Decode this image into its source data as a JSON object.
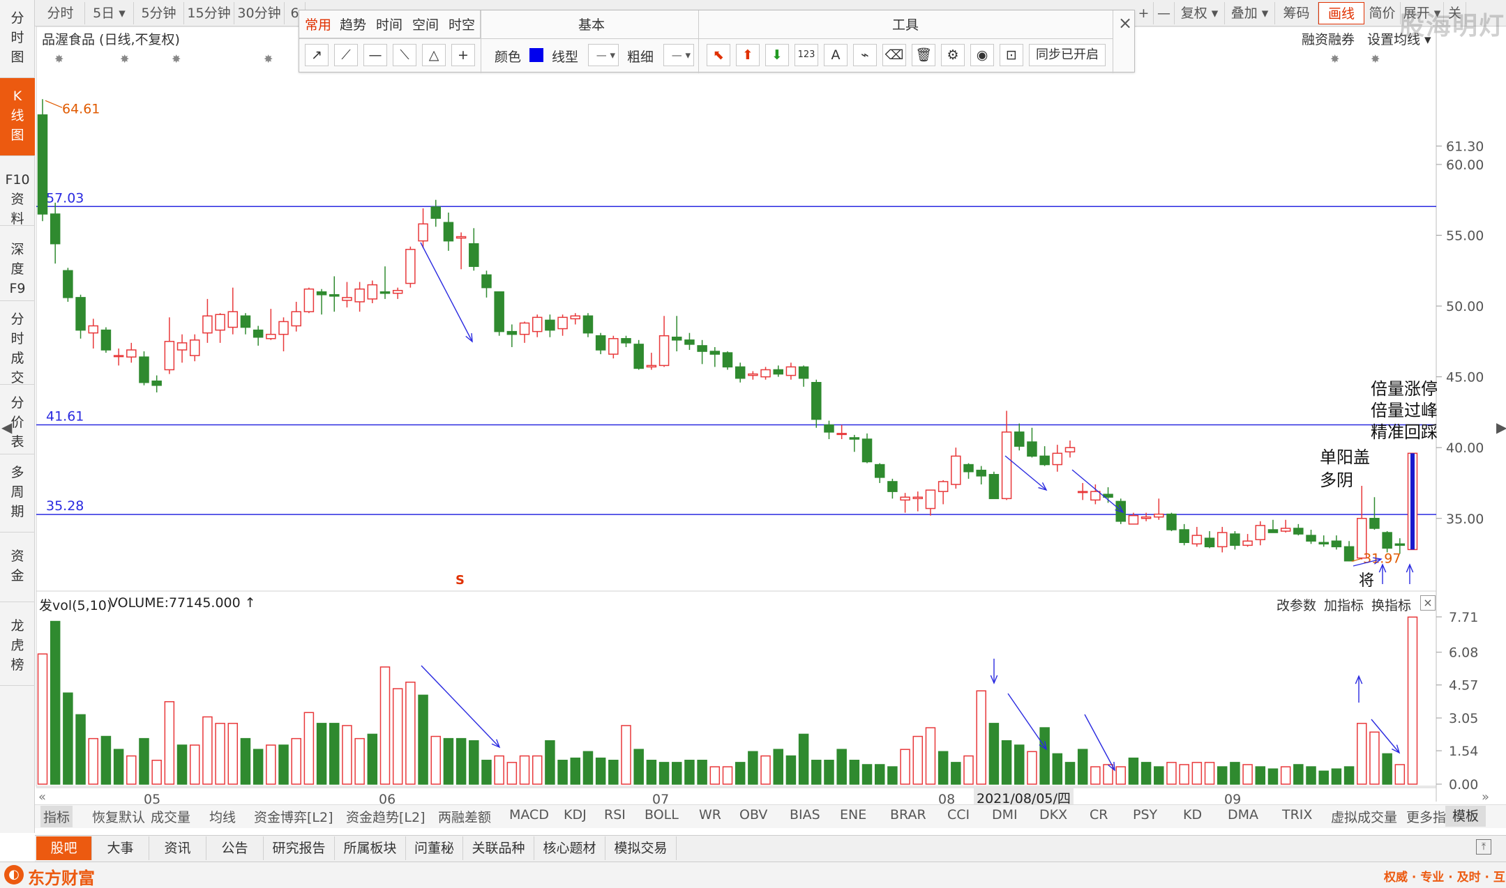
{
  "sidebar": [
    {
      "label": "分\n时\n图",
      "active": false
    },
    {
      "label": "K\n线\n图",
      "active": true
    },
    {
      "label": "F10\n资\n料",
      "active": false
    },
    {
      "label": "深\n度\nF9",
      "active": false
    },
    {
      "label": "分\n时\n成\n交",
      "active": false
    },
    {
      "label": "分\n价\n表",
      "active": false
    },
    {
      "label": "多\n周\n期",
      "active": false
    },
    {
      "label": "资\n金",
      "active": false
    },
    {
      "label": "龙\n虎\n榜",
      "active": false
    }
  ],
  "period_tabs": [
    "分时",
    "5日 ▾",
    "5分钟",
    "15分钟",
    "30分钟",
    "6"
  ],
  "right_tabs": [
    "+",
    "—",
    "复权 ▾",
    "叠加 ▾",
    "筹码",
    "画线",
    "简价",
    "展开 ▾",
    "关"
  ],
  "active_right_tab": "画线",
  "stock_title": "品渥食品 (日线,不复权)",
  "links": {
    "margin": "融资融券",
    "ma": "设置均线 ▾"
  },
  "toolbox": {
    "tabs": [
      "常用",
      "趋势",
      "时间",
      "空间",
      "时空"
    ],
    "section_basic": "基本",
    "section_tools": "工具",
    "color_label": "颜色",
    "line_label": "线型",
    "width_label": "粗细",
    "sync_label": "同步已开启",
    "close": "×"
  },
  "price_labels": [
    "61.30",
    "60.00",
    "55.00",
    "50.00",
    "45.00",
    "40.00",
    "35.00"
  ],
  "hlines": [
    {
      "value": 57.03,
      "label": "57.03"
    },
    {
      "value": 41.61,
      "label": "41.61"
    },
    {
      "value": 35.28,
      "label": "35.28"
    }
  ],
  "high_marker": "64.61",
  "low_marker": "31.97",
  "s_marker": "S",
  "jiang_marker": "将",
  "annotations": {
    "a1": "倍量涨停",
    "a2": "倍量过峰",
    "a3": "精准回踩",
    "b1": "单阳盖",
    "b2": "多阴"
  },
  "volume": {
    "title": "发vol(5,10)",
    "value_text": "VOLUME:77145.000 ↑",
    "actions": [
      "改参数",
      "加指标",
      "换指标"
    ],
    "scale": [
      "7.71",
      "6.08",
      "4.57",
      "3.05",
      "1.54",
      "0.00"
    ]
  },
  "month_labels": [
    "05",
    "06",
    "07",
    "08",
    "2021/08/05/四",
    "09"
  ],
  "indicator_tabs": [
    "指标",
    "恢复默认",
    "成交量",
    "均线",
    "资金博弈[L2]",
    "资金趋势[L2]",
    "两融差额",
    "MACD",
    "KDJ",
    "RSI",
    "BOLL",
    "WR",
    "OBV",
    "BIAS",
    "ENE",
    "BRAR",
    "CCI",
    "DMI",
    "DKX",
    "CR",
    "PSY",
    "KD",
    "DMA",
    "TRIX",
    "虚拟成交量",
    "更多指标"
  ],
  "template_tab": "模板",
  "bottom_tabs": [
    "股吧",
    "大事",
    "资讯",
    "公告",
    "研究报告",
    "所属板块",
    "问董秘",
    "关联品种",
    "核心题材",
    "模拟交易"
  ],
  "brand": "东方财富",
  "slogan": "权威 · 专业 · 及时 · 互动",
  "watermark": "股海明灯",
  "colors": {
    "up": "#e8383a",
    "down": "#2f8a2f",
    "accent": "#ec5a10",
    "hline": "#2a2ae0"
  },
  "chart_data": {
    "type": "candlestick",
    "ylim": [
      31.0,
      66.2
    ],
    "candles": [
      [
        63.5,
        56.5,
        64.61,
        56.0
      ],
      [
        56.5,
        54.4,
        57.3,
        53.0
      ],
      [
        52.5,
        50.6,
        52.7,
        50.3
      ],
      [
        50.6,
        48.3,
        50.8,
        47.7
      ],
      [
        48.1,
        48.6,
        49.1,
        47.0
      ],
      [
        48.3,
        46.9,
        48.5,
        46.7
      ],
      [
        46.5,
        46.5,
        47.0,
        45.8
      ],
      [
        46.4,
        46.9,
        47.4,
        46.0
      ],
      [
        46.4,
        44.6,
        46.8,
        44.4
      ],
      [
        44.7,
        44.4,
        45.1,
        43.9
      ],
      [
        45.5,
        47.5,
        49.2,
        45.2
      ],
      [
        46.9,
        47.4,
        48.0,
        46.0
      ],
      [
        46.5,
        47.6,
        48.0,
        46.1
      ],
      [
        48.1,
        49.3,
        50.5,
        47.4
      ],
      [
        48.3,
        49.4,
        49.5,
        47.4
      ],
      [
        48.5,
        49.6,
        51.3,
        48.0
      ],
      [
        49.3,
        48.5,
        49.5,
        48.0
      ],
      [
        48.3,
        47.8,
        48.6,
        47.2
      ],
      [
        47.7,
        48.0,
        49.8,
        47.6
      ],
      [
        48.0,
        48.9,
        49.2,
        46.8
      ],
      [
        48.6,
        49.6,
        50.3,
        48.2
      ],
      [
        49.6,
        51.2,
        51.3,
        49.5
      ],
      [
        51.0,
        50.8,
        51.2,
        49.4
      ],
      [
        50.8,
        50.7,
        52.1,
        49.6
      ],
      [
        50.4,
        50.6,
        51.7,
        49.9
      ],
      [
        50.3,
        51.2,
        51.7,
        49.6
      ],
      [
        50.5,
        51.5,
        51.8,
        50.2
      ],
      [
        51.0,
        50.9,
        52.8,
        50.5
      ],
      [
        50.9,
        51.1,
        51.3,
        50.5
      ],
      [
        51.6,
        54.0,
        54.2,
        51.3
      ],
      [
        54.6,
        55.8,
        56.9,
        54.1
      ],
      [
        57.0,
        56.2,
        57.5,
        55.6
      ],
      [
        55.9,
        54.6,
        56.6,
        53.9
      ],
      [
        54.8,
        54.9,
        55.2,
        52.6
      ],
      [
        54.4,
        52.8,
        55.5,
        52.5
      ],
      [
        52.2,
        51.3,
        52.5,
        50.6
      ],
      [
        51.0,
        48.2,
        51.0,
        47.9
      ],
      [
        48.2,
        48.0,
        48.7,
        47.1
      ],
      [
        48.0,
        48.8,
        48.9,
        47.4
      ],
      [
        48.2,
        49.2,
        49.4,
        47.8
      ],
      [
        49.0,
        48.3,
        49.4,
        47.8
      ],
      [
        48.4,
        49.2,
        49.4,
        47.9
      ],
      [
        49.1,
        49.3,
        49.5,
        48.7
      ],
      [
        49.3,
        48.1,
        49.5,
        47.8
      ],
      [
        47.9,
        46.9,
        48.1,
        46.6
      ],
      [
        46.6,
        47.7,
        47.9,
        46.3
      ],
      [
        47.7,
        47.4,
        47.9,
        47.1
      ],
      [
        47.3,
        45.6,
        47.6,
        45.5
      ],
      [
        45.7,
        45.8,
        46.7,
        45.5
      ],
      [
        45.8,
        47.9,
        49.3,
        45.7
      ],
      [
        47.8,
        47.6,
        49.3,
        46.8
      ],
      [
        47.6,
        47.3,
        48.1,
        46.9
      ],
      [
        47.2,
        46.8,
        47.6,
        45.9
      ],
      [
        46.8,
        46.6,
        47.1,
        45.7
      ],
      [
        46.7,
        45.7,
        46.8,
        45.5
      ],
      [
        45.7,
        44.9,
        46.0,
        44.6
      ],
      [
        45.1,
        45.2,
        45.4,
        44.8
      ],
      [
        45.0,
        45.5,
        45.7,
        44.8
      ],
      [
        45.5,
        45.2,
        45.8,
        45.0
      ],
      [
        45.1,
        45.7,
        46.0,
        44.8
      ],
      [
        45.7,
        44.9,
        45.8,
        44.3
      ],
      [
        44.6,
        42.0,
        44.8,
        41.4
      ],
      [
        41.6,
        41.1,
        41.9,
        40.6
      ],
      [
        41.0,
        41.0,
        41.6,
        40.6
      ],
      [
        40.7,
        40.6,
        40.9,
        39.7
      ],
      [
        40.6,
        39.0,
        41.0,
        38.9
      ],
      [
        38.8,
        37.9,
        38.9,
        37.5
      ],
      [
        37.6,
        36.9,
        37.8,
        36.4
      ],
      [
        36.3,
        36.5,
        36.8,
        35.4
      ],
      [
        36.4,
        36.5,
        36.9,
        35.5
      ],
      [
        35.7,
        37.0,
        37.0,
        35.2
      ],
      [
        36.9,
        37.6,
        37.7,
        36.0
      ],
      [
        37.4,
        39.4,
        40.0,
        37.1
      ],
      [
        38.8,
        38.3,
        38.9,
        37.8
      ],
      [
        38.4,
        38.0,
        38.7,
        37.4
      ],
      [
        38.1,
        36.4,
        38.3,
        36.4
      ],
      [
        36.4,
        41.1,
        42.6,
        36.3
      ],
      [
        41.1,
        40.1,
        41.7,
        39.8
      ],
      [
        40.4,
        39.4,
        41.4,
        39.3
      ],
      [
        39.4,
        38.8,
        40.1,
        38.7
      ],
      [
        38.8,
        39.6,
        40.2,
        38.3
      ],
      [
        39.7,
        40.0,
        40.5,
        39.3
      ],
      [
        36.9,
        36.9,
        37.5,
        36.3
      ],
      [
        36.3,
        36.9,
        37.4,
        36.0
      ],
      [
        36.7,
        36.5,
        37.2,
        36.1
      ],
      [
        36.2,
        34.8,
        36.4,
        34.6
      ],
      [
        34.6,
        35.2,
        35.4,
        34.7
      ],
      [
        35.0,
        35.1,
        35.4,
        34.8
      ],
      [
        35.1,
        35.3,
        36.4,
        34.9
      ],
      [
        35.3,
        34.2,
        35.4,
        34.1
      ],
      [
        34.2,
        33.3,
        34.6,
        33.1
      ],
      [
        33.2,
        33.8,
        34.4,
        33.0
      ],
      [
        33.6,
        33.0,
        34.1,
        32.9
      ],
      [
        33.0,
        34.0,
        34.4,
        32.6
      ],
      [
        33.9,
        33.1,
        34.1,
        32.8
      ],
      [
        33.1,
        33.4,
        33.9,
        33.0
      ],
      [
        33.5,
        34.5,
        34.8,
        33.1
      ],
      [
        34.2,
        34.0,
        34.9,
        34.0
      ],
      [
        34.1,
        34.3,
        34.9,
        34.0
      ],
      [
        34.3,
        33.9,
        34.6,
        33.8
      ],
      [
        33.8,
        33.4,
        34.2,
        33.2
      ],
      [
        33.3,
        33.2,
        33.8,
        33.0
      ],
      [
        33.4,
        33.0,
        33.8,
        32.8
      ],
      [
        33.0,
        32.0,
        33.4,
        31.97
      ],
      [
        32.2,
        35.0,
        37.3,
        32.1
      ],
      [
        35.0,
        34.3,
        36.5,
        34.2
      ],
      [
        34.0,
        32.9,
        34.1,
        32.6
      ],
      [
        33.2,
        33.1,
        33.6,
        32.5
      ],
      [
        32.8,
        39.6,
        39.6,
        32.8
      ]
    ],
    "volume_ylim": [
      0,
      7.71
    ],
    "volumes": [
      [
        6.0,
        1
      ],
      [
        7.5,
        0
      ],
      [
        4.2,
        0
      ],
      [
        3.2,
        0
      ],
      [
        2.1,
        1
      ],
      [
        2.2,
        0
      ],
      [
        1.6,
        0
      ],
      [
        1.3,
        1
      ],
      [
        2.1,
        0
      ],
      [
        1.1,
        1
      ],
      [
        3.8,
        1
      ],
      [
        1.8,
        0
      ],
      [
        1.8,
        1
      ],
      [
        3.1,
        1
      ],
      [
        2.8,
        1
      ],
      [
        2.8,
        1
      ],
      [
        2.1,
        0
      ],
      [
        1.6,
        0
      ],
      [
        1.8,
        1
      ],
      [
        1.8,
        0
      ],
      [
        2.1,
        1
      ],
      [
        3.3,
        1
      ],
      [
        2.8,
        0
      ],
      [
        2.8,
        0
      ],
      [
        2.7,
        1
      ],
      [
        2.1,
        1
      ],
      [
        2.3,
        0
      ],
      [
        5.4,
        1
      ],
      [
        4.4,
        1
      ],
      [
        4.7,
        1
      ],
      [
        4.1,
        0
      ],
      [
        2.2,
        1
      ],
      [
        2.1,
        0
      ],
      [
        2.1,
        0
      ],
      [
        2.0,
        0
      ],
      [
        1.1,
        0
      ],
      [
        1.3,
        1
      ],
      [
        1.0,
        1
      ],
      [
        1.3,
        1
      ],
      [
        1.3,
        1
      ],
      [
        2.0,
        0
      ],
      [
        1.1,
        0
      ],
      [
        1.2,
        0
      ],
      [
        1.5,
        0
      ],
      [
        1.2,
        0
      ],
      [
        1.1,
        0
      ],
      [
        2.7,
        1
      ],
      [
        1.6,
        0
      ],
      [
        1.1,
        0
      ],
      [
        1.0,
        0
      ],
      [
        1.0,
        0
      ],
      [
        1.1,
        0
      ],
      [
        1.1,
        0
      ],
      [
        0.8,
        1
      ],
      [
        0.8,
        1
      ],
      [
        1.0,
        0
      ],
      [
        1.5,
        0
      ],
      [
        1.3,
        1
      ],
      [
        1.6,
        0
      ],
      [
        1.3,
        0
      ],
      [
        2.3,
        0
      ],
      [
        1.1,
        0
      ],
      [
        1.1,
        0
      ],
      [
        1.6,
        0
      ],
      [
        1.1,
        0
      ],
      [
        0.9,
        0
      ],
      [
        0.9,
        0
      ],
      [
        0.8,
        0
      ],
      [
        1.6,
        1
      ],
      [
        2.2,
        1
      ],
      [
        2.6,
        1
      ],
      [
        1.5,
        0
      ],
      [
        1.0,
        0
      ],
      [
        1.3,
        1
      ],
      [
        4.3,
        1
      ],
      [
        2.8,
        0
      ],
      [
        2.0,
        0
      ],
      [
        1.8,
        0
      ],
      [
        1.5,
        1
      ],
      [
        2.6,
        0
      ],
      [
        1.4,
        0
      ],
      [
        1.0,
        0
      ],
      [
        1.6,
        0
      ],
      [
        0.8,
        1
      ],
      [
        0.9,
        1
      ],
      [
        0.8,
        1
      ],
      [
        1.2,
        0
      ],
      [
        1.0,
        0
      ],
      [
        0.8,
        0
      ],
      [
        1.0,
        1
      ],
      [
        0.9,
        1
      ],
      [
        1.0,
        1
      ],
      [
        1.0,
        1
      ],
      [
        0.8,
        0
      ],
      [
        1.0,
        0
      ],
      [
        0.9,
        1
      ],
      [
        0.8,
        0
      ],
      [
        0.7,
        0
      ],
      [
        0.8,
        1
      ],
      [
        0.9,
        0
      ],
      [
        0.8,
        0
      ],
      [
        0.6,
        0
      ],
      [
        0.7,
        0
      ],
      [
        0.8,
        0
      ],
      [
        2.8,
        1
      ],
      [
        2.4,
        1
      ],
      [
        1.4,
        0
      ],
      [
        0.9,
        1
      ],
      [
        7.7,
        1
      ]
    ]
  }
}
